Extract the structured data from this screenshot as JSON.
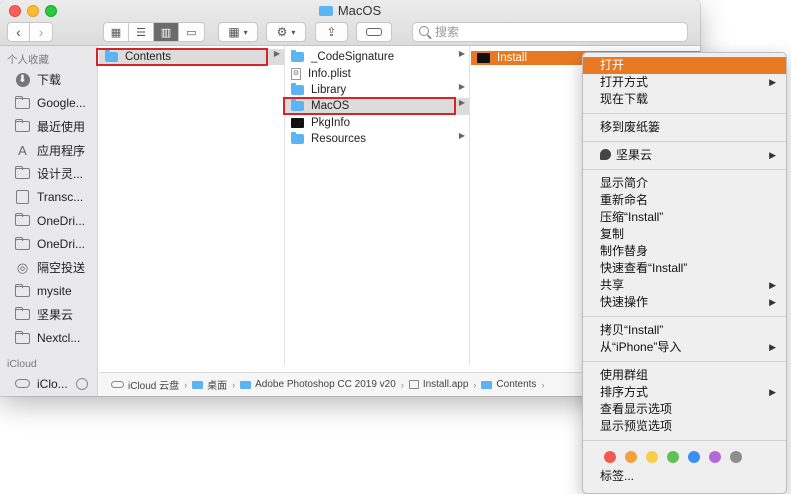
{
  "window": {
    "title": "MacOS",
    "search_placeholder": "搜索",
    "nav": {
      "back": "‹",
      "forward": "›"
    }
  },
  "sidebar": {
    "favorites_header": "个人收藏",
    "items": [
      {
        "label": "下载",
        "icon": "download-icon"
      },
      {
        "label": "Google...",
        "icon": "folder-icon"
      },
      {
        "label": "最近使用",
        "icon": "folder-icon"
      },
      {
        "label": "应用程序",
        "icon": "applications-icon"
      },
      {
        "label": "设计灵...",
        "icon": "folder-icon"
      },
      {
        "label": "Transc...",
        "icon": "document-icon"
      },
      {
        "label": "OneDri...",
        "icon": "folder-icon"
      },
      {
        "label": "OneDri...",
        "icon": "folder-icon"
      },
      {
        "label": "隔空投送",
        "icon": "airdrop-icon"
      },
      {
        "label": "mysite",
        "icon": "folder-icon"
      },
      {
        "label": "坚果云",
        "icon": "folder-icon"
      },
      {
        "label": "Nextcl...",
        "icon": "folder-icon"
      }
    ],
    "icloud_header": "iCloud",
    "icloud_items": [
      {
        "label": "iClo...",
        "icon": "cloud-icon"
      }
    ]
  },
  "columns": {
    "col1": [
      {
        "label": "Contents",
        "type": "folder",
        "has_children": true,
        "selected": true
      }
    ],
    "col2": [
      {
        "label": "_CodeSignature",
        "type": "folder",
        "has_children": true
      },
      {
        "label": "Info.plist",
        "type": "document",
        "has_children": false
      },
      {
        "label": "Library",
        "type": "folder",
        "has_children": true
      },
      {
        "label": "MacOS",
        "type": "folder",
        "has_children": true,
        "selected": true
      },
      {
        "label": "PkgInfo",
        "type": "executable",
        "has_children": false
      },
      {
        "label": "Resources",
        "type": "folder",
        "has_children": true
      }
    ],
    "col3": [
      {
        "label": "Install",
        "type": "executable",
        "selected": true
      }
    ]
  },
  "pathbar": {
    "segments": [
      "iCloud 云盘",
      "桌面",
      "Adobe Photoshop CC 2019 v20",
      "Install.app",
      "Contents"
    ]
  },
  "context_menu": {
    "groups": [
      [
        {
          "label": "打开",
          "highlighted": true
        },
        {
          "label": "打开方式",
          "submenu": true
        },
        {
          "label": "现在下载"
        }
      ],
      [
        {
          "label": "移到废纸篓"
        }
      ],
      [
        {
          "label": "坚果云",
          "submenu": true,
          "icon": "jianguoyun-icon"
        }
      ],
      [
        {
          "label": "显示简介"
        },
        {
          "label": "重新命名"
        },
        {
          "label": "压缩“Install”"
        },
        {
          "label": "复制"
        },
        {
          "label": "制作替身"
        },
        {
          "label": "快速查看“Install”"
        },
        {
          "label": "共享",
          "submenu": true
        },
        {
          "label": "快速操作",
          "submenu": true
        }
      ],
      [
        {
          "label": "拷贝“Install”"
        },
        {
          "label": "从“iPhone”导入",
          "submenu": true
        }
      ],
      [
        {
          "label": "使用群组"
        },
        {
          "label": "排序方式",
          "submenu": true
        },
        {
          "label": "查看显示选项"
        },
        {
          "label": "显示预览选项"
        }
      ]
    ],
    "tag_colors": [
      "#f05a4f",
      "#f5a03a",
      "#f7ce46",
      "#5fc354",
      "#3a8ef6",
      "#b26ad8",
      "#8e8e8e"
    ],
    "tags_label": "标签..."
  },
  "colors": {
    "selection_orange": "#e87922",
    "highlight_box_red": "#d9232a",
    "folder_blue": "#5cb4f2"
  }
}
